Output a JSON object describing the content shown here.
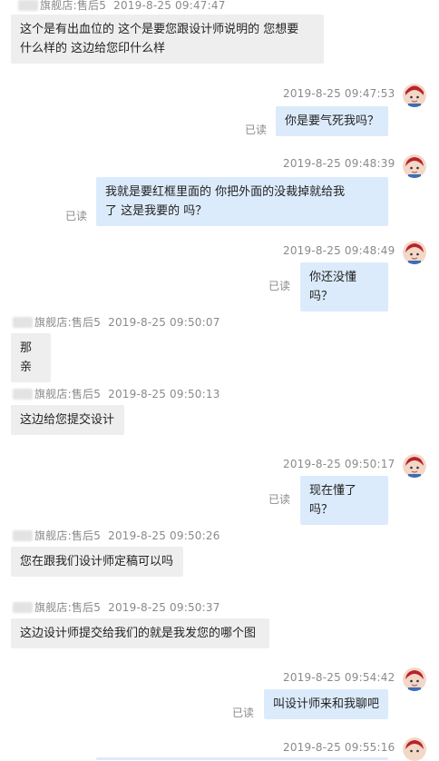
{
  "messages": [
    {
      "side": "left",
      "sender": "旗舰店:售后5",
      "time": "2019-8-25 09:47:47",
      "lines": [
        "这个是有出血位的  这个是要您跟设计师说明的  您想要",
        "什么样的  这边给您印什么样"
      ]
    },
    {
      "side": "right",
      "time": "2019-8-25 09:47:53",
      "read": "已读",
      "lines": [
        "你是要气死我吗？"
      ]
    },
    {
      "side": "right",
      "time": "2019-8-25 09:48:39",
      "read": "已读",
      "lines": [
        "我就是要红框里面的  你把外面的没裁掉就给我",
        "了    这是我要的 吗？"
      ]
    },
    {
      "side": "right",
      "time": "2019-8-25 09:48:49",
      "read": "已读",
      "lines": [
        "你还没懂吗？"
      ]
    },
    {
      "side": "left",
      "sender": "旗舰店:售后5",
      "time": "2019-8-25 09:50:07",
      "lines": [
        "那亲"
      ]
    },
    {
      "side": "left",
      "sender": "旗舰店:售后5",
      "time": "2019-8-25 09:50:13",
      "lines": [
        "这边给您提交设计"
      ]
    },
    {
      "side": "right",
      "time": "2019-8-25 09:50:17",
      "read": "已读",
      "lines": [
        "现在懂了吗？"
      ]
    },
    {
      "side": "left",
      "sender": "旗舰店:售后5",
      "time": "2019-8-25 09:50:26",
      "lines": [
        "您在跟我们设计师定稿可以吗"
      ]
    },
    {
      "side": "left",
      "sender": "旗舰店:售后5",
      "time": "2019-8-25 09:50:37",
      "lines": [
        "这边设计师提交给我们的就是我发您的哪个图"
      ]
    },
    {
      "side": "right",
      "time": "2019-8-25 09:54:42",
      "read": "已读",
      "lines": [
        "叫设计师来和我聊吧"
      ]
    },
    {
      "side": "right",
      "time": "2019-8-25 09:55:16",
      "read": "",
      "lines": []
    }
  ],
  "colors": {
    "left_bubble": "#eeeeee",
    "right_bubble": "#dcebfb",
    "meta": "#8a8a8a"
  },
  "icons": {
    "avatar": "user-avatar-icon"
  }
}
